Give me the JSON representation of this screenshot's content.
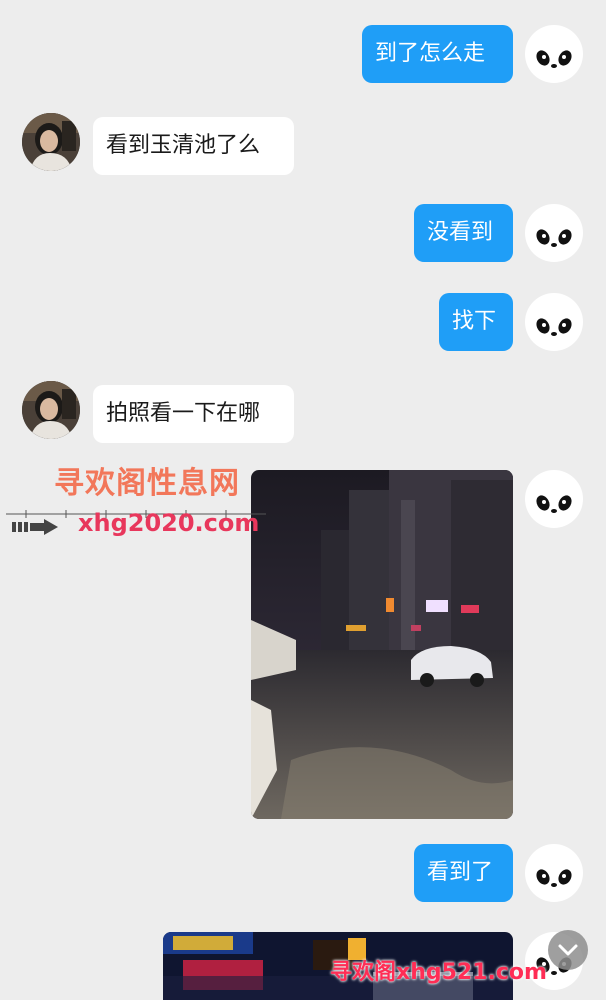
{
  "messages": {
    "m1": "到了怎么走",
    "m2": "看到玉清池了么",
    "m3": "没看到",
    "m4": "找下",
    "m5": "拍照看一下在哪",
    "m6": "看到了"
  },
  "watermarks": {
    "site_name": "寻欢阁性息网",
    "site_url": "xhg2020.com",
    "bottom_mark": "寻欢阁xhg521.com"
  },
  "colors": {
    "outgoing_bubble": "#1f9ef7",
    "incoming_bubble": "#ffffff",
    "background": "#ededed"
  },
  "icons": {
    "self_avatar": "panda-face",
    "contact_avatar": "person-photo",
    "scroll_down": "chevron-down-icon"
  }
}
